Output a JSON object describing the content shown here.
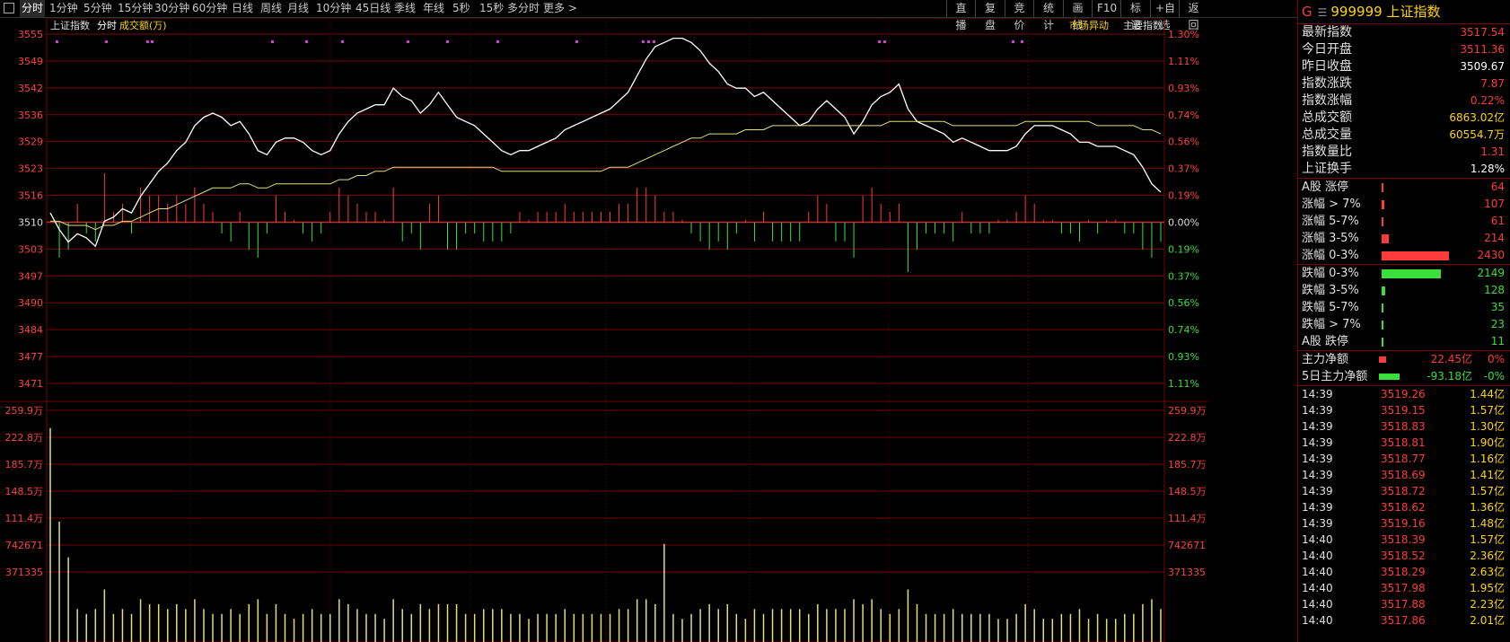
{
  "toolbar": {
    "periods": [
      "分时",
      "1分钟",
      "5分钟",
      "15分钟",
      "30分钟",
      "60分钟",
      "日线",
      "周线",
      "月线",
      "10分钟",
      "45日线",
      "季线",
      "年线",
      "5秒",
      "15秒",
      "多分时",
      "更多 >"
    ],
    "right_buttons": [
      "直播",
      "复盘",
      "竞价",
      "统计",
      "画线",
      "F10",
      "标记",
      "+自选",
      "返回"
    ]
  },
  "chart": {
    "legend": {
      "index_name": "上证指数",
      "mode": "分时",
      "volume_label": "成交额(万)"
    },
    "buttons": {
      "market_move": "市场异动",
      "main_index": "主要指数"
    },
    "colors": {
      "index_line": "#ffffff",
      "avg_line": "#e0e07a",
      "up": "#ff3a3a",
      "down": "#3adf3a",
      "grid": "#7a0000",
      "axis_text": "#ff4040"
    }
  },
  "chart_data": {
    "type": "line",
    "price_axis": {
      "ticks": [
        "3555",
        "3549",
        "3542",
        "3536",
        "3529",
        "3523",
        "3516",
        "3510",
        "3503",
        "3497",
        "3490",
        "3484",
        "3477",
        "3471"
      ],
      "min": 3471,
      "max": 3555,
      "base": 3509.67
    },
    "pct_axis": {
      "ticks": [
        "1.30%",
        "1.11%",
        "0.93%",
        "0.74%",
        "0.56%",
        "0.37%",
        "0.19%",
        "0.00%",
        "0.19%",
        "0.37%",
        "0.56%",
        "0.74%",
        "0.93%",
        "1.11%"
      ]
    },
    "volume_axis": {
      "ticks": [
        "259.9万",
        "222.8万",
        "185.7万",
        "148.5万",
        "111.4万",
        "742671",
        "371335"
      ],
      "max": 2599000
    },
    "series": [
      {
        "points": [
          3512,
          3508,
          3505,
          3507,
          3506,
          3504,
          3510,
          3511,
          3513,
          3512,
          3516,
          3519,
          3522,
          3524,
          3527,
          3529,
          3533,
          3535,
          3536,
          3535,
          3533,
          3534,
          3531,
          3527,
          3526,
          3529,
          3530,
          3530,
          3529,
          3527,
          3526,
          3527,
          3531,
          3534,
          3536,
          3537,
          3538,
          3538,
          3542,
          3540,
          3539,
          3536,
          3538,
          3541,
          3538,
          3535,
          3534,
          3533,
          3531,
          3529,
          3527,
          3526,
          3527,
          3527,
          3528,
          3529,
          3530,
          3532,
          3533,
          3534,
          3535,
          3536,
          3537,
          3539,
          3541,
          3545,
          3549,
          3552,
          3553,
          3554,
          3554,
          3553,
          3551,
          3548,
          3546,
          3543,
          3542,
          3542,
          3540,
          3541,
          3539,
          3537,
          3535,
          3533,
          3534,
          3537,
          3539,
          3537,
          3535,
          3531,
          3534,
          3538,
          3540,
          3541,
          3543,
          3537,
          3534,
          3533,
          3532,
          3531,
          3529,
          3530,
          3529,
          3528,
          3527,
          3527,
          3527,
          3528,
          3531,
          3533,
          3533,
          3533,
          3532,
          3531,
          3529,
          3529,
          3528,
          3528,
          3528,
          3527,
          3526,
          3523,
          3519,
          3517
        ],
        "name": ""
      },
      {
        "points": [
          3510,
          3510,
          3509,
          3509,
          3509,
          3508,
          3509,
          3509,
          3510,
          3510,
          3511,
          3512,
          3513,
          3513,
          3514,
          3515,
          3516,
          3517,
          3518,
          3518,
          3518,
          3519,
          3519,
          3518,
          3518,
          3519,
          3519,
          3519,
          3519,
          3519,
          3519,
          3519,
          3520,
          3520,
          3521,
          3521,
          3522,
          3522,
          3523,
          3523,
          3523,
          3523,
          3523,
          3523,
          3523,
          3523,
          3523,
          3523,
          3523,
          3523,
          3522,
          3522,
          3522,
          3522,
          3522,
          3522,
          3522,
          3522,
          3522,
          3522,
          3522,
          3522,
          3523,
          3523,
          3523,
          3524,
          3525,
          3526,
          3527,
          3528,
          3529,
          3530,
          3530,
          3531,
          3531,
          3531,
          3531,
          3532,
          3532,
          3532,
          3533,
          3533,
          3533,
          3533,
          3533,
          3533,
          3533,
          3533,
          3533,
          3533,
          3533,
          3533,
          3533,
          3534,
          3534,
          3534,
          3534,
          3534,
          3534,
          3534,
          3533,
          3533,
          3533,
          3533,
          3533,
          3533,
          3533,
          3533,
          3534,
          3534,
          3534,
          3534,
          3534,
          3534,
          3534,
          3534,
          3533,
          3533,
          3533,
          3533,
          3533,
          3532,
          3532,
          3531
        ],
        "name": ""
      }
    ]
  },
  "panel": {
    "code": "G",
    "star": "☰",
    "symbol": "999999",
    "name": "上证指数",
    "stats": [
      {
        "label": "最新指数",
        "value": "3517.54",
        "color": "red"
      },
      {
        "label": "今日开盘",
        "value": "3511.36",
        "color": "red"
      },
      {
        "label": "昨日收盘",
        "value": "3509.67",
        "color": "white"
      },
      {
        "label": "指数涨跌",
        "value": "7.87",
        "color": "red"
      },
      {
        "label": "指数涨幅",
        "value": "0.22%",
        "color": "red"
      },
      {
        "label": "总成交额",
        "value": "6863.02亿",
        "color": "yellow"
      },
      {
        "label": "总成交量",
        "value": "60554.7万",
        "color": "yellow"
      },
      {
        "label": "指数量比",
        "value": "1.31",
        "color": "red"
      },
      {
        "label": "上证换手",
        "value": "1.28%",
        "color": "white"
      }
    ],
    "breadth_up": [
      {
        "label": "A股 涨停",
        "value": "64",
        "bar": 0.013
      },
      {
        "label": "涨幅 > 7%",
        "value": "107",
        "bar": 0.02
      },
      {
        "label": "涨幅 5-7%",
        "value": "61",
        "bar": 0.013
      },
      {
        "label": "涨幅 3-5%",
        "value": "214",
        "bar": 0.05
      },
      {
        "label": "涨幅 0-3%",
        "value": "2430",
        "bar": 0.5
      }
    ],
    "breadth_down": [
      {
        "label": "跌幅 0-3%",
        "value": "2149",
        "bar": 0.44
      },
      {
        "label": "跌幅 3-5%",
        "value": "128",
        "bar": 0.025
      },
      {
        "label": "跌幅 5-7%",
        "value": "35",
        "bar": 0.007
      },
      {
        "label": "跌幅 > 7%",
        "value": "23",
        "bar": 0.005
      },
      {
        "label": "A股 跌停",
        "value": "11",
        "bar": 0.003
      }
    ],
    "flows": [
      {
        "label": "主力净额",
        "amount": "22.45亿",
        "pct": "0%",
        "color": "red",
        "bar": 0.05
      },
      {
        "label": "5日主力净额",
        "amount": "-93.18亿",
        "pct": "-0%",
        "color": "green",
        "bar": 0.15
      }
    ],
    "ticks": [
      {
        "time": "14:39",
        "price": "3519.26",
        "vol": "1.44亿"
      },
      {
        "time": "14:39",
        "price": "3519.15",
        "vol": "1.57亿"
      },
      {
        "time": "14:39",
        "price": "3518.83",
        "vol": "1.30亿"
      },
      {
        "time": "14:39",
        "price": "3518.81",
        "vol": "1.90亿"
      },
      {
        "time": "14:39",
        "price": "3518.77",
        "vol": "1.16亿"
      },
      {
        "time": "14:39",
        "price": "3518.69",
        "vol": "1.41亿"
      },
      {
        "time": "14:39",
        "price": "3518.72",
        "vol": "1.57亿"
      },
      {
        "time": "14:39",
        "price": "3518.62",
        "vol": "1.36亿"
      },
      {
        "time": "14:39",
        "price": "3519.16",
        "vol": "1.48亿"
      },
      {
        "time": "14:40",
        "price": "3518.39",
        "vol": "1.57亿"
      },
      {
        "time": "14:40",
        "price": "3518.52",
        "vol": "2.36亿"
      },
      {
        "time": "14:40",
        "price": "3518.29",
        "vol": "2.63亿"
      },
      {
        "time": "14:40",
        "price": "3517.98",
        "vol": "1.95亿"
      },
      {
        "time": "14:40",
        "price": "3517.88",
        "vol": "2.23亿"
      },
      {
        "time": "14:40",
        "price": "3517.86",
        "vol": "2.01亿"
      }
    ]
  }
}
